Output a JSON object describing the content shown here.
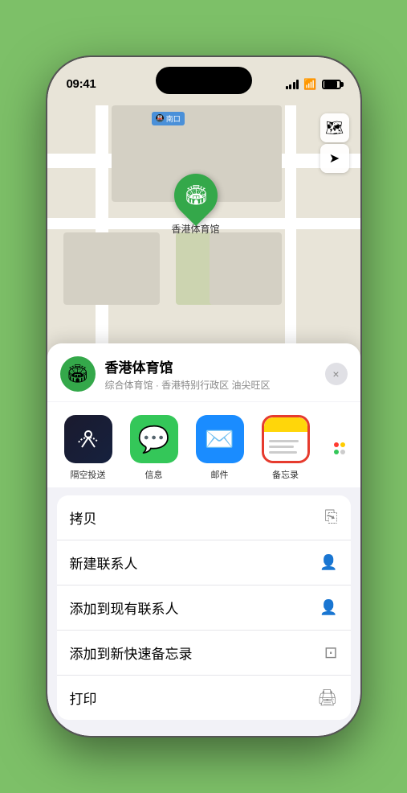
{
  "status_bar": {
    "time": "09:41",
    "location_arrow": "▶"
  },
  "map": {
    "label_text": "南口",
    "marker_emoji": "🏟",
    "marker_label": "香港体育馆",
    "control_map": "🗺",
    "control_location": "➤"
  },
  "venue_card": {
    "name": "香港体育馆",
    "subtitle": "综合体育馆 · 香港特别行政区 油尖旺区",
    "close_label": "×",
    "venue_emoji": "🏟"
  },
  "share_items": [
    {
      "label": "隔空投送",
      "type": "airdrop"
    },
    {
      "label": "信息",
      "type": "messages"
    },
    {
      "label": "邮件",
      "type": "mail"
    },
    {
      "label": "备忘录",
      "type": "notes"
    }
  ],
  "actions": [
    {
      "label": "拷贝",
      "icon": "⎘"
    },
    {
      "label": "新建联系人",
      "icon": "👤"
    },
    {
      "label": "添加到现有联系人",
      "icon": "👤"
    },
    {
      "label": "添加到新快速备忘录",
      "icon": "⊡"
    },
    {
      "label": "打印",
      "icon": "🖨"
    }
  ]
}
